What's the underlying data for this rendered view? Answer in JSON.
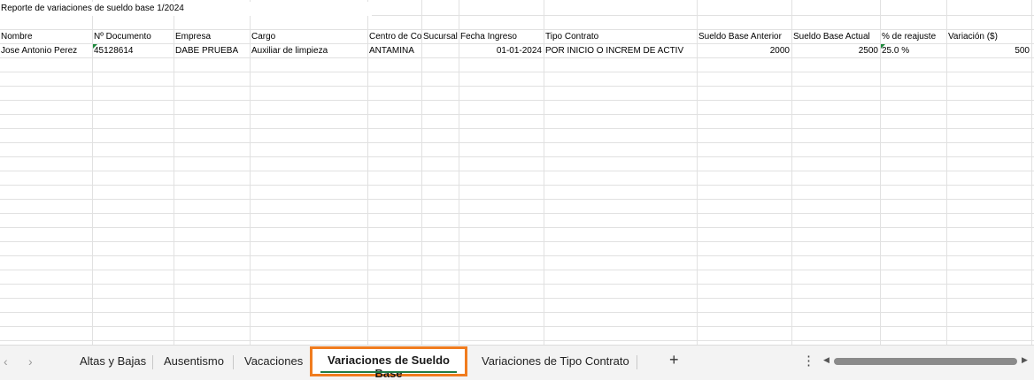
{
  "sheet": {
    "title_cell": "Reporte de variaciones de sueldo base 1/2024",
    "headers": [
      "Nombre",
      "Nº Documento",
      "Empresa",
      "Cargo",
      "Centro de Costo",
      "Sucursal",
      "Fecha Ingreso",
      "Tipo Contrato",
      "Sueldo Base Anterior",
      "Sueldo Base Actual",
      "% de reajuste",
      "Variación ($)"
    ],
    "rows": [
      [
        "Jose Antonio Perez",
        "45128614",
        "DABE PRUEBA",
        "Auxiliar de limpieza",
        "ANTAMINA",
        "",
        "01-01-2024",
        "POR INICIO O INCREM DE ACTIV",
        "2000",
        "2500",
        "25.0 %",
        "500"
      ]
    ]
  },
  "tabs": {
    "prev_icon": "chevron-left-icon",
    "next_icon": "chevron-right-icon",
    "items": [
      "Altas y Bajas",
      "Ausentismo",
      "Vacaciones",
      "Variaciones de Sueldo Base",
      "Variaciones de Tipo Contrato"
    ],
    "active": "Variaciones de Sueldo Base",
    "active_outline_color": "#f07c1f",
    "active_underline_color": "#1e7b45",
    "add_icon": "plus-icon",
    "more_icon": "vertical-ellipsis-icon"
  }
}
